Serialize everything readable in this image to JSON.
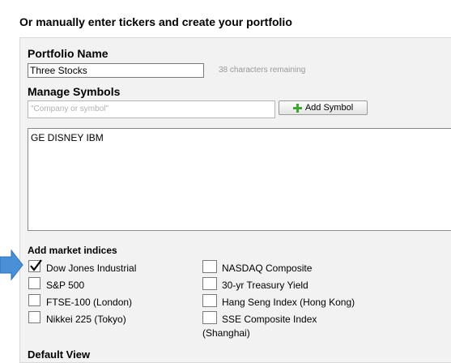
{
  "heading": "Or manually enter tickers and create your portfolio",
  "portfolio_name": {
    "label": "Portfolio Name",
    "value": "Three Stocks",
    "remaining": "38 characters remaining"
  },
  "manage_symbols": {
    "label": "Manage Symbols",
    "placeholder": "\"Company or symbol\"",
    "add_button": "Add Symbol",
    "symbols_text": "GE DISNEY IBM"
  },
  "market_indices": {
    "label": "Add market indices",
    "left": [
      {
        "label": "Dow Jones Industrial",
        "checked": true
      },
      {
        "label": "S&P 500",
        "checked": false
      },
      {
        "label": "FTSE-100 (London)",
        "checked": false
      },
      {
        "label": "Nikkei 225 (Tokyo)",
        "checked": false
      }
    ],
    "right": [
      {
        "label": "NASDAQ Composite",
        "checked": false
      },
      {
        "label": "30-yr Treasury Yield",
        "checked": false
      },
      {
        "label": "Hang Seng Index (Hong Kong)",
        "checked": false
      },
      {
        "label": "SSE Composite Index",
        "label_line2": "(Shanghai)",
        "checked": false
      }
    ]
  },
  "default_view": {
    "label": "Default View"
  },
  "colors": {
    "plus_icon": "#3fa535",
    "pointer_arrow": "#4a90d9"
  }
}
